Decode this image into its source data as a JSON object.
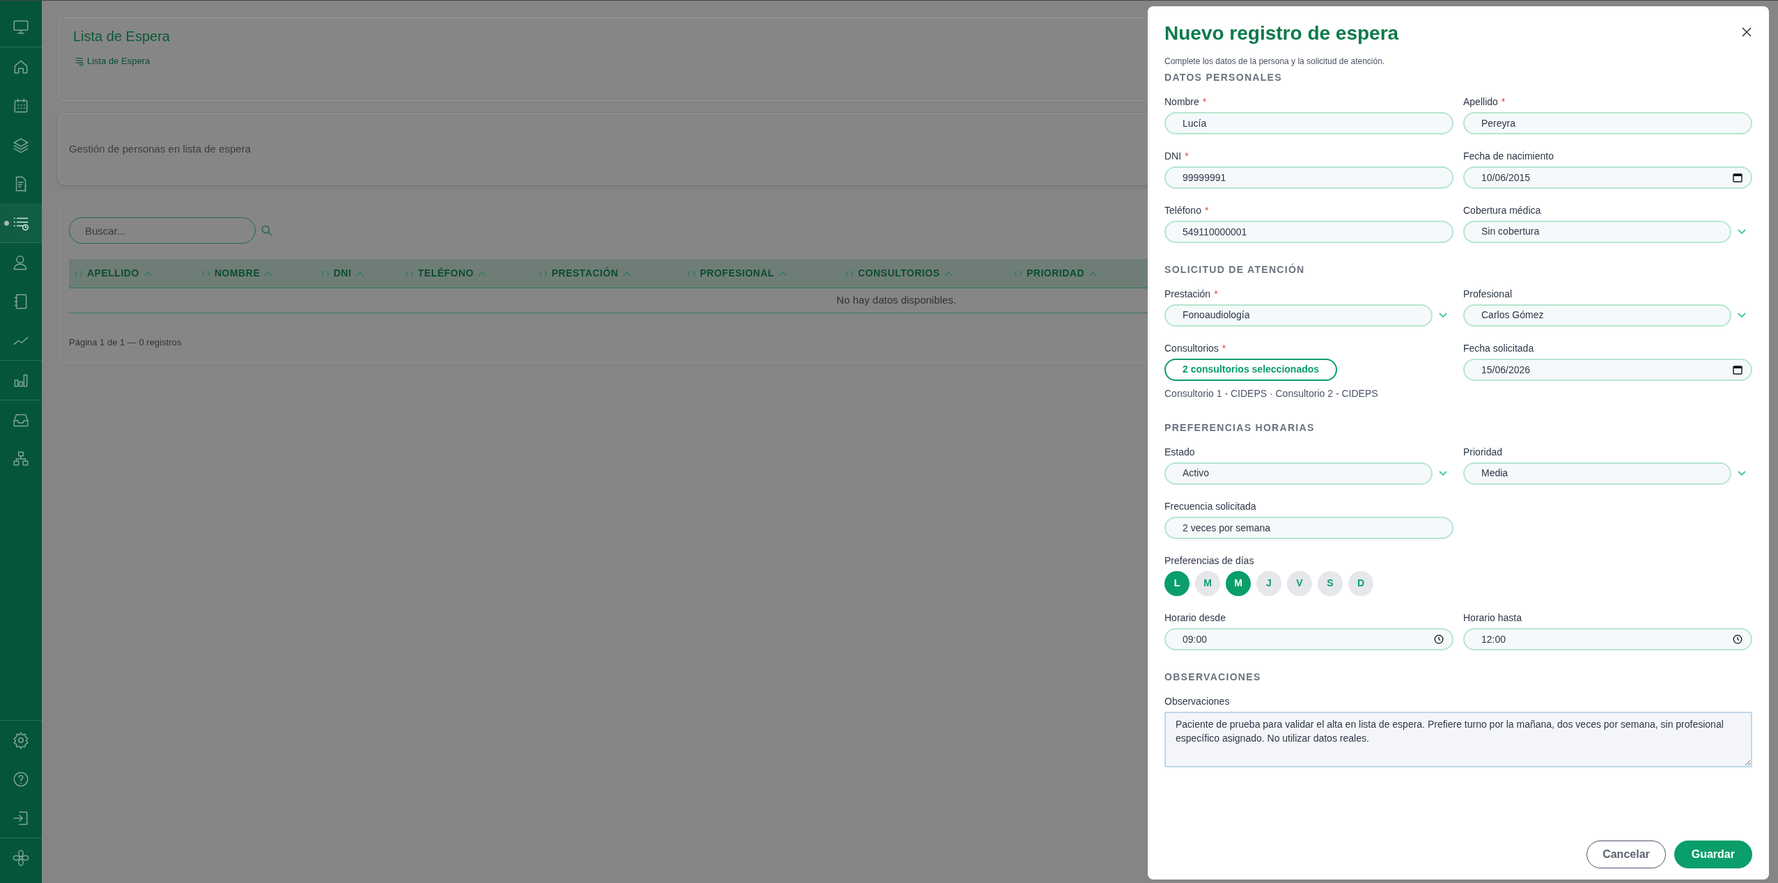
{
  "sidebar": {
    "top": [
      [
        {
          "selected": false
        }
      ],
      [
        {
          "selected": false
        },
        {
          "selected": false
        },
        {
          "selected": false
        },
        {
          "selected": false
        },
        {
          "selected": true
        }
      ],
      [
        {
          "selected": false
        },
        {
          "selected": false
        },
        {
          "selected": false
        }
      ],
      [
        {
          "selected": false
        }
      ],
      [
        {
          "selected": false
        },
        {
          "selected": false
        }
      ]
    ],
    "bottom": [
      [
        {
          "selected": false
        },
        {
          "selected": false
        },
        {
          "selected": false
        }
      ],
      [
        {
          "selected": false
        }
      ]
    ]
  },
  "header": {
    "title": "Lista de Espera",
    "breadcrumb": "Lista de Espera"
  },
  "description": "Gestión de personas en lista de espera",
  "search": {
    "placeholder": "Buscar..."
  },
  "table": {
    "columns": [
      "APELLIDO",
      "NOMBRE",
      "DNI",
      "TELÉFONO",
      "PRESTACIÓN",
      "PROFESIONAL",
      "CONSULTORIOS",
      "PRIORIDAD"
    ],
    "empty_message": "No hay datos disponibles."
  },
  "pagination": "Página 1 de 1 — 0 registros",
  "modal": {
    "title": "Nuevo registro de espera",
    "subtitle": "Complete los datos de la persona y la solicitud de atención.",
    "sections": [
      {
        "heading": "DATOS PERSONALES",
        "fields": [
          {
            "label": "Nombre",
            "required_mark": "*",
            "kind": "text",
            "value": "Lucía"
          },
          {
            "label": "Apellido",
            "required_mark": "*",
            "kind": "text",
            "value": "Pereyra"
          },
          {
            "label": "DNI",
            "required_mark": "*",
            "kind": "text",
            "value": "99999991"
          },
          {
            "label": "Fecha de nacimiento",
            "kind": "date",
            "value": "10/06/2015"
          },
          {
            "label": "Teléfono",
            "required_mark": "*",
            "kind": "text",
            "value": "549110000001"
          },
          {
            "label": "Cobertura médica",
            "kind": "select",
            "value": "Sin cobertura"
          }
        ]
      },
      {
        "heading": "SOLICITUD DE ATENCIÓN",
        "fields": [
          {
            "label": "Prestación",
            "required_mark": "*",
            "kind": "select",
            "value": "Fonoaudiología"
          },
          {
            "label": "Profesional",
            "kind": "select",
            "value": "Carlos Gómez"
          },
          {
            "label": "Consultorios",
            "required_mark": "*",
            "kind": "multiselect",
            "value": "2 consultorios seleccionados",
            "note": "Consultorio 1 - CIDEPS · Consultorio 2 - CIDEPS"
          },
          {
            "label": "Fecha solicitada",
            "kind": "date",
            "value": "15/06/2026"
          }
        ]
      },
      {
        "heading": "PREFERENCIAS HORARIAS",
        "fields": [
          {
            "label": "Estado",
            "kind": "select",
            "value": "Activo"
          },
          {
            "label": "Prioridad",
            "kind": "select",
            "value": "Media"
          },
          {
            "label": "Frecuencia solicitada",
            "kind": "text",
            "value": "2 veces por semana"
          },
          {
            "label": "Preferencias de días",
            "kind": "days",
            "days": [
              {
                "label": "L",
                "selected": true
              },
              {
                "label": "M",
                "selected": false
              },
              {
                "label": "M",
                "selected": true
              },
              {
                "label": "J",
                "selected": false
              },
              {
                "label": "V",
                "selected": false
              },
              {
                "label": "S",
                "selected": false
              },
              {
                "label": "D",
                "selected": false
              }
            ]
          },
          {
            "label": "Horario desde",
            "kind": "time",
            "value": "09:00"
          },
          {
            "label": "Horario hasta",
            "kind": "time",
            "value": "12:00"
          }
        ]
      },
      {
        "heading": "OBSERVACIONES",
        "fields": [
          {
            "label": "Observaciones",
            "kind": "textarea",
            "value": "Paciente de prueba para validar el alta en lista de espera. Prefiere turno por la mañana, dos veces por semana, sin profesional específico asignado. No utilizar datos reales."
          }
        ]
      }
    ],
    "buttons": [
      {
        "label": "Cancelar",
        "kind": "secondary"
      },
      {
        "label": "Guardar",
        "kind": "primary"
      }
    ]
  }
}
